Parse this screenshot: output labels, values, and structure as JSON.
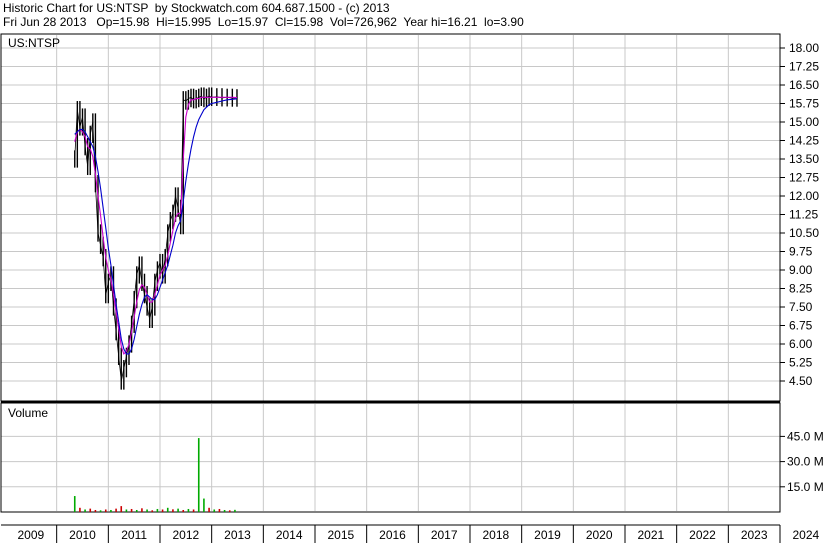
{
  "header": {
    "line1": "Historic Chart for US:NTSP  by Stockwatch.com 604.687.1500 - (c) 2013",
    "line2": "Fri Jun 28 2013   Op=15.98  Hi=15.995  Lo=15.97  Cl=15.98  Vol=726,962  Year hi=16.21  lo=3.90"
  },
  "colors": {
    "price_bars": "#000000",
    "ma_short": "#cc00cc",
    "ma_long": "#0000cc",
    "volume_up": "#00aa00",
    "volume_down": "#cc0000",
    "grid": "#c8c8c8"
  },
  "chart_data": [
    {
      "type": "line",
      "label": "US:NTSP",
      "ylim": [
        3.9,
        18.5
      ],
      "yticks": [
        "18.00",
        "17.25",
        "16.50",
        "15.75",
        "15.00",
        "14.25",
        "13.50",
        "12.75",
        "12.00",
        "11.25",
        "10.50",
        "9.75",
        "9.00",
        "8.25",
        "7.50",
        "6.75",
        "6.00",
        "5.25",
        "4.50"
      ],
      "x_years": [
        "2009",
        "2010",
        "2011",
        "2012",
        "2013",
        "2014",
        "2015",
        "2016",
        "2017",
        "2018",
        "2019",
        "2020",
        "2021",
        "2022",
        "2023",
        "2024"
      ],
      "x": [
        2010.35,
        2010.4,
        2010.45,
        2010.5,
        2010.55,
        2010.6,
        2010.65,
        2010.7,
        2010.75,
        2010.8,
        2010.85,
        2010.9,
        2010.95,
        2011.0,
        2011.05,
        2011.1,
        2011.15,
        2011.2,
        2011.25,
        2011.3,
        2011.35,
        2011.4,
        2011.45,
        2011.5,
        2011.55,
        2011.6,
        2011.65,
        2011.7,
        2011.75,
        2011.8,
        2011.85,
        2011.9,
        2011.95,
        2012.0,
        2012.05,
        2012.1,
        2012.15,
        2012.2,
        2012.25,
        2012.3,
        2012.35,
        2012.4,
        2012.45,
        2012.5,
        2012.55,
        2012.6,
        2012.65,
        2012.7,
        2012.75,
        2012.8,
        2012.85,
        2012.9,
        2012.95,
        2013.0,
        2013.1,
        2013.2,
        2013.3,
        2013.4,
        2013.49
      ],
      "series": [
        {
          "name": "Price",
          "values": [
            13.5,
            15.5,
            14.8,
            15.2,
            14.0,
            13.2,
            14.5,
            15.0,
            12.5,
            10.5,
            10.0,
            9.5,
            8.0,
            8.5,
            8.8,
            7.5,
            6.5,
            5.5,
            4.5,
            5.0,
            5.5,
            6.0,
            6.8,
            7.8,
            8.8,
            9.2,
            8.5,
            8.0,
            7.5,
            7.0,
            7.5,
            8.5,
            9.0,
            9.3,
            8.8,
            9.5,
            10.5,
            11.0,
            11.3,
            12.0,
            11.5,
            10.8,
            15.9,
            15.85,
            15.95,
            16.0,
            15.9,
            15.95,
            16.0,
            16.05,
            15.95,
            16.0,
            16.05,
            16.0,
            16.02,
            15.98,
            16.0,
            15.97,
            15.98
          ]
        },
        {
          "name": "",
          "values": [
            14.2,
            14.6,
            14.7,
            14.6,
            14.4,
            14.0,
            13.9,
            13.6,
            12.9,
            12.0,
            11.2,
            10.3,
            9.5,
            9.0,
            8.6,
            8.0,
            7.3,
            6.6,
            5.9,
            5.6,
            5.7,
            6.0,
            6.5,
            7.1,
            7.7,
            8.2,
            8.4,
            8.3,
            8.0,
            7.7,
            7.7,
            8.0,
            8.4,
            8.8,
            9.0,
            9.2,
            9.6,
            10.1,
            10.6,
            11.1,
            11.3,
            11.3,
            13.5,
            15.2,
            15.7,
            15.9,
            15.9,
            15.95,
            15.95,
            16.0,
            16.0,
            16.0,
            16.0,
            16.0,
            16.0,
            16.0,
            16.0,
            16.0,
            15.99
          ]
        },
        {
          "name": "",
          "values": [
            14.5,
            14.6,
            14.7,
            14.7,
            14.6,
            14.4,
            14.2,
            14.0,
            13.6,
            13.0,
            12.3,
            11.5,
            10.7,
            9.9,
            9.2,
            8.4,
            7.6,
            6.9,
            6.2,
            5.8,
            5.6,
            5.6,
            5.8,
            6.2,
            6.7,
            7.2,
            7.6,
            7.9,
            8.0,
            7.9,
            7.8,
            7.8,
            8.0,
            8.3,
            8.6,
            8.9,
            9.2,
            9.6,
            10.0,
            10.5,
            10.8,
            11.0,
            11.8,
            12.6,
            13.3,
            13.9,
            14.4,
            14.8,
            15.1,
            15.3,
            15.5,
            15.6,
            15.7,
            15.75,
            15.8,
            15.85,
            15.9,
            15.92,
            15.94
          ]
        }
      ]
    },
    {
      "type": "bar",
      "label": "Volume",
      "ylim": [
        0,
        50
      ],
      "yticks": [
        "45.0 M",
        "30.0 M",
        "15.0 M"
      ],
      "x": [
        2010.35,
        2010.45,
        2010.55,
        2010.65,
        2010.75,
        2010.85,
        2010.95,
        2011.05,
        2011.15,
        2011.25,
        2011.35,
        2011.45,
        2011.55,
        2011.65,
        2011.75,
        2011.85,
        2011.95,
        2012.05,
        2012.15,
        2012.25,
        2012.35,
        2012.45,
        2012.55,
        2012.65,
        2012.75,
        2012.85,
        2012.95,
        2013.05,
        2013.15,
        2013.25,
        2013.35,
        2013.45
      ],
      "values": [
        9.5,
        2.5,
        1.5,
        2.0,
        1.2,
        1.0,
        1.5,
        1.2,
        2.0,
        3.5,
        1.5,
        1.8,
        1.2,
        2.2,
        1.5,
        1.0,
        1.8,
        1.5,
        2.5,
        1.6,
        2.0,
        1.2,
        1.8,
        1.5,
        44.0,
        8.0,
        2.5,
        1.5,
        1.8,
        1.2,
        1.0,
        1.3
      ],
      "up": [
        true,
        false,
        true,
        false,
        false,
        true,
        false,
        true,
        false,
        false,
        true,
        false,
        true,
        false,
        true,
        false,
        true,
        false,
        true,
        false,
        true,
        false,
        true,
        false,
        true,
        true,
        false,
        true,
        false,
        true,
        false,
        true
      ]
    }
  ]
}
